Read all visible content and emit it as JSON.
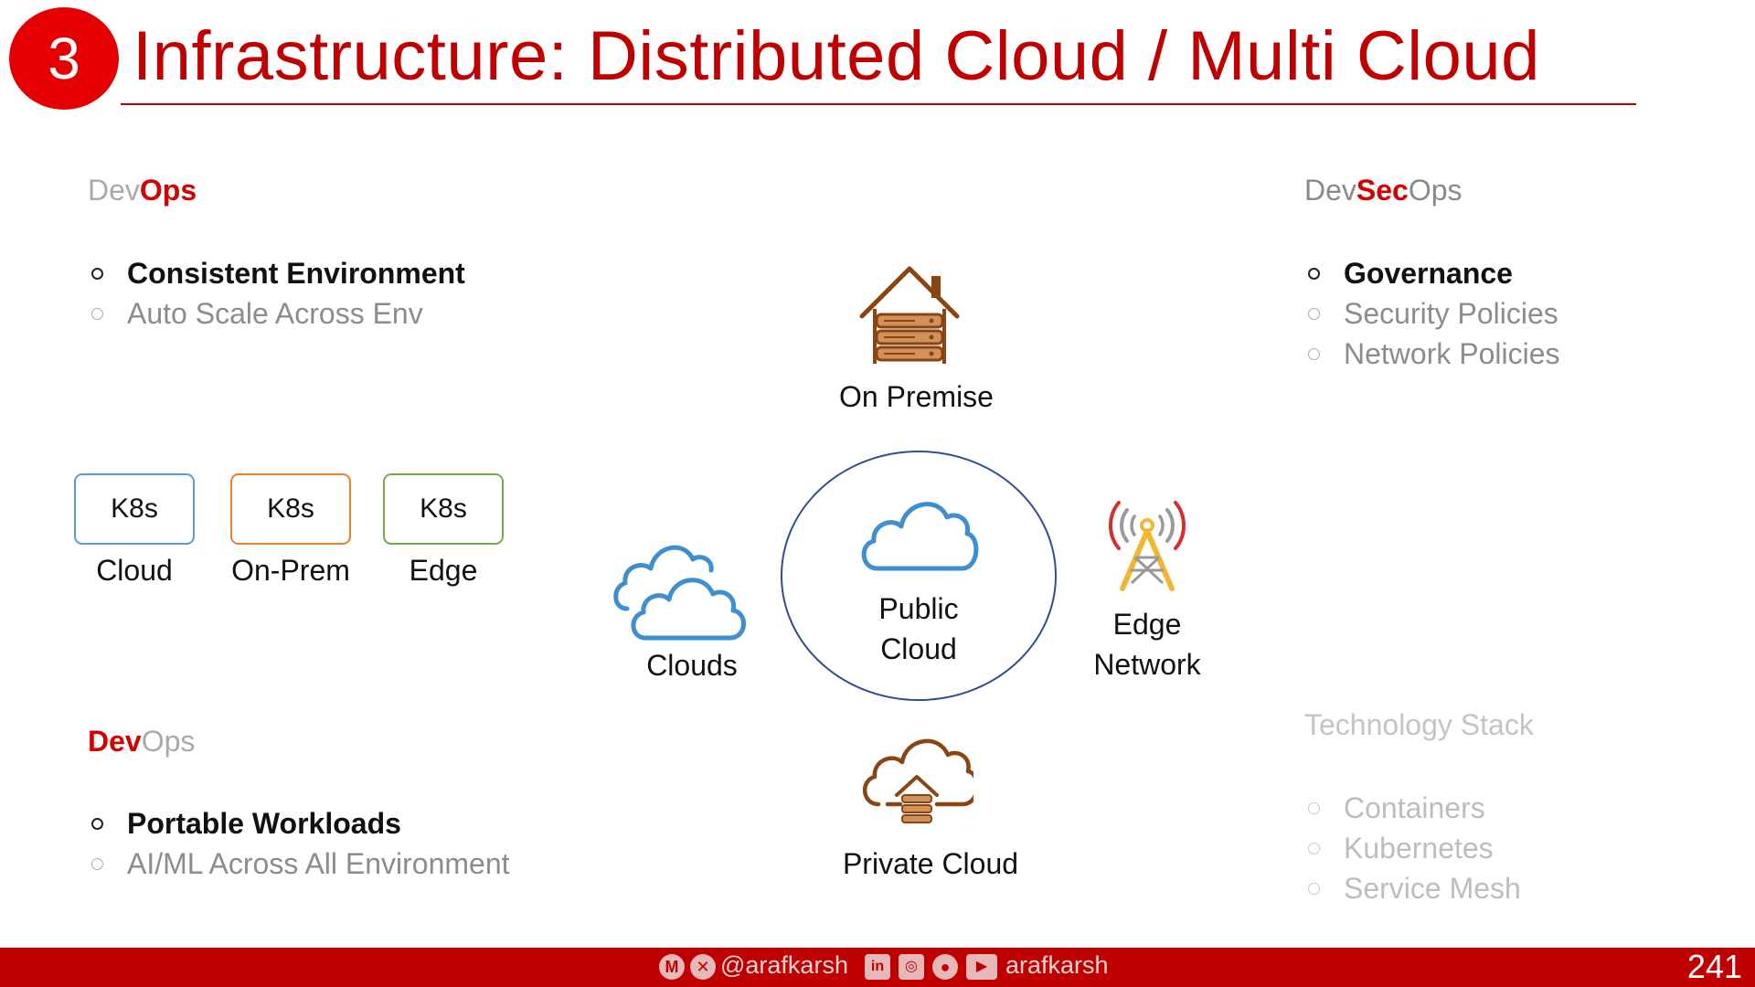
{
  "header": {
    "badge_number": "3",
    "title": "Infrastructure: Distributed Cloud / Multi Cloud"
  },
  "devops_top": {
    "prefix": "Dev",
    "suffix": "Ops",
    "items": [
      {
        "label": "Consistent Environment"
      },
      {
        "label": "Auto Scale Across Env"
      }
    ]
  },
  "devsecops": {
    "part1": "Dev",
    "part2": "Sec",
    "part3": "Ops",
    "items": [
      {
        "label": "Governance"
      },
      {
        "label": "Security Policies"
      },
      {
        "label": "Network Policies"
      }
    ]
  },
  "k8s": [
    {
      "box": "K8s",
      "label": "Cloud",
      "color": "#5b9bd5"
    },
    {
      "box": "K8s",
      "label": "On-Prem",
      "color": "#ed7d31"
    },
    {
      "box": "K8s",
      "label": "Edge",
      "color": "#70ad47"
    }
  ],
  "diagram": {
    "on_premise": "On Premise",
    "clouds": "Clouds",
    "public_cloud_line1": "Public",
    "public_cloud_line2": "Cloud",
    "edge_line1": "Edge",
    "edge_line2": "Network",
    "private_cloud": "Private Cloud"
  },
  "devops_bottom": {
    "prefix": "Dev",
    "suffix": "Ops",
    "items": [
      {
        "label": "Portable Workloads"
      },
      {
        "label": "AI/ML Across All Environment"
      }
    ]
  },
  "tech_stack": {
    "title": "Technology Stack",
    "items": [
      {
        "label": "Containers"
      },
      {
        "label": "Kubernetes"
      },
      {
        "label": "Service Mesh"
      }
    ]
  },
  "footer": {
    "handle": "@arafkarsh",
    "name": "arafkarsh",
    "page_number": "241"
  },
  "colors": {
    "brand_red": "#c00000",
    "badge_red": "#e40000",
    "cloud_blue": "#5b9bd5",
    "circle_navy": "#2f4f8f",
    "building_brown": "#a0522d"
  }
}
